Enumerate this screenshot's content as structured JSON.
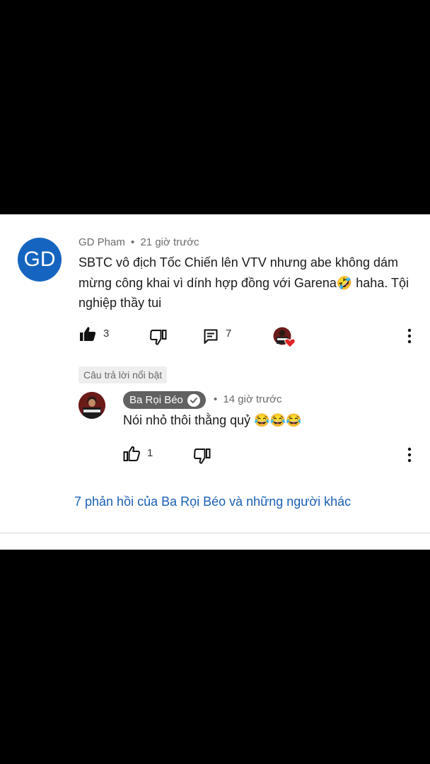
{
  "comment": {
    "avatar_initials": "GD",
    "author": "GD Pham",
    "separator": "•",
    "time": "21 giờ trước",
    "text": "SBTC vô địch Tốc Chiến lên VTV nhưng abe không dám mừng công khai vì dính hợp đồng với Garena🤣 haha. Tội nghiệp thầy tui",
    "like_count": "3",
    "reply_count": "7"
  },
  "featured_label": "Câu trả lời nổi bật",
  "reply": {
    "author": "Ba Rọi Béo",
    "separator": "•",
    "time": "14 giờ trước",
    "text": "Nói nhỏ thôi thằng quỷ 😂😂😂",
    "like_count": "1"
  },
  "more_replies_link": "7 phản hồi của Ba Rọi Béo và những người khác",
  "colors": {
    "avatar_bg": "#1565c0",
    "link": "#1a5fb4",
    "author_chip_bg": "#616161",
    "heart": "#e02424"
  }
}
